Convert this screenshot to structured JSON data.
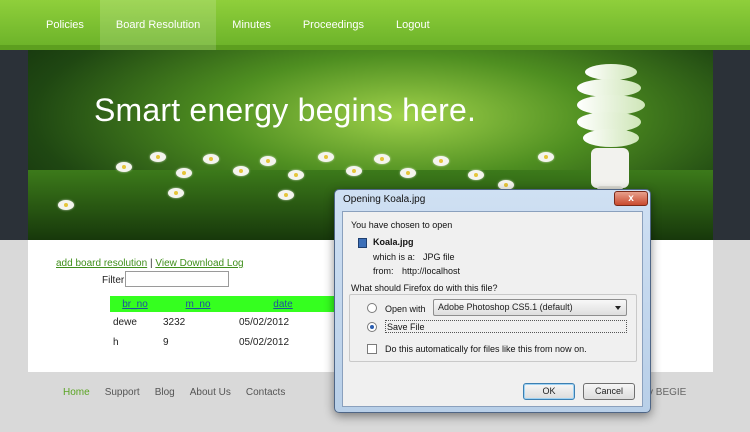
{
  "nav": {
    "items": [
      {
        "label": "Policies"
      },
      {
        "label": "Board Resolution"
      },
      {
        "label": "Minutes"
      },
      {
        "label": "Proceedings"
      },
      {
        "label": "Logout"
      }
    ],
    "active": "Board Resolution"
  },
  "hero": {
    "headline": "Smart energy begins here."
  },
  "content": {
    "add_link": "add board resolution",
    "separator": "|",
    "log_link": "View Download Log",
    "filter_label": "Filter",
    "filter_value": "",
    "table": {
      "headers": [
        "br_no",
        "m_no",
        "date",
        ""
      ],
      "rows": [
        [
          "dewe",
          "3232",
          "05/02/2012",
          ""
        ],
        [
          "h",
          "9",
          "05/02/2012",
          ""
        ]
      ]
    }
  },
  "footer": {
    "links": [
      {
        "label": "Home",
        "active": true
      },
      {
        "label": "Support"
      },
      {
        "label": "Blog"
      },
      {
        "label": "About Us"
      },
      {
        "label": "Contacts"
      }
    ],
    "credit_partial": "y BEGIE"
  },
  "dialog": {
    "title": "Opening Koala.jpg",
    "close_label": "x",
    "intro": "You have chosen to open",
    "filename": "Koala.jpg",
    "which_is_label": "which is a:",
    "which_is_value": "JPG file",
    "from_label": "from:",
    "from_value": "http://localhost",
    "question": "What should Firefox do with this file?",
    "open_with_label": "Open with",
    "open_with_app": "Adobe Photoshop CS5.1 (default)",
    "save_label": "Save File",
    "save_selected": true,
    "auto_label": "Do this automatically for files like this from now on.",
    "ok_label": "OK",
    "cancel_label": "Cancel"
  },
  "colors": {
    "nav_green": "#6ab128",
    "table_header": "#35ff1f",
    "link_green": "#3f8e1a",
    "dialog_frame": "#b8cfe8"
  }
}
